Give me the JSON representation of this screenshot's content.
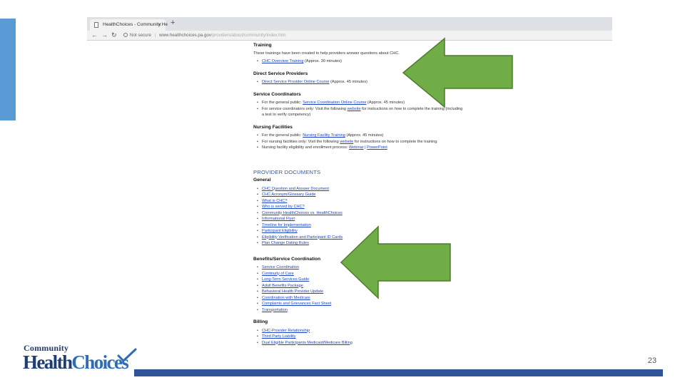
{
  "slide": {
    "number": "23",
    "colors": {
      "left_bar": "#5b9bd5",
      "bottom_bar": "#2e5597",
      "arrow_fill": "#70ad47",
      "arrow_stroke": "#4e7d2d"
    }
  },
  "logo": {
    "community": "Community",
    "health": "Health",
    "choices": "Choices"
  },
  "browser": {
    "tab_title": "HealthChoices - Community He",
    "new_tab_icon": "plus-icon",
    "nav_icons": [
      "back-arrow-icon",
      "forward-arrow-icon",
      "reload-icon"
    ],
    "not_secure": "Not secure",
    "url_host": "www.healthchoices.pa.gov",
    "url_path": "/providers/about/community/index.htm"
  },
  "page": {
    "training": {
      "heading": "Training",
      "intro": "These trainings have been created to help providers answer questions about CHC.",
      "items": [
        {
          "link": "CHC Overview Training",
          "rest": " (Approx. 30 minutes)"
        }
      ]
    },
    "direct_service": {
      "heading": "Direct Service Providers",
      "items": [
        {
          "link": "Direct Service Provider Online Course",
          "rest": " (Approx. 45 minutes)"
        }
      ]
    },
    "service_coordinators": {
      "heading": "Service Coordinators",
      "items": [
        {
          "pre": "For the general public: ",
          "link": "Service Coordination Online Course",
          "rest": " (Approx. 45 minutes)"
        },
        {
          "pre": "For service coordinators only: Visit the following ",
          "link": "website",
          "rest": " for instructions on how to complete the training (including a test to verify competency)"
        }
      ]
    },
    "nursing": {
      "heading": "Nursing Facilities",
      "items": [
        {
          "pre": "For the general public: ",
          "link": "Nursing Facility Training",
          "rest": " (Approx. 45 minutes)"
        },
        {
          "pre": "For nursing facilities only: Visit the following ",
          "link": "website",
          "rest": " for instructions on how to complete the training"
        },
        {
          "pre": "Nursing facility eligibility and enrollment process: ",
          "link": "Webinar",
          "mid": " | ",
          "link2": "PowerPoint"
        }
      ]
    },
    "provider_documents": {
      "heading": "PROVIDER DOCUMENTS",
      "general": {
        "heading": "General",
        "items": [
          "CHC Question and Answer Document",
          "CHC Acronym/Glossary Guide",
          "What is CHC?",
          "Who is served by CHC?",
          "Community HealthChoices vs. HealthChoices",
          "Informational Flyer",
          "Timeline for Implementation",
          "Participant Eligibility",
          "Eligibility Verification and Participant ID Cards",
          "Plan Change Dating Rules"
        ]
      },
      "benefits": {
        "heading": "Benefits/Service Coordination",
        "items": [
          "Service Coordination",
          "Continuity of Care",
          "Long-Term Services Guide",
          "Adult Benefits Package",
          "Behavioral Health Provider Update",
          "Coordination with Medicare",
          "Complaints and Grievances Fact Sheet",
          "Transportation"
        ]
      },
      "billing": {
        "heading": "Billing",
        "items": [
          "CHC-Provider Relationship",
          "Third Party Liability",
          "Dual Eligible Participants Medicaid/Medicare Billing"
        ]
      }
    }
  }
}
